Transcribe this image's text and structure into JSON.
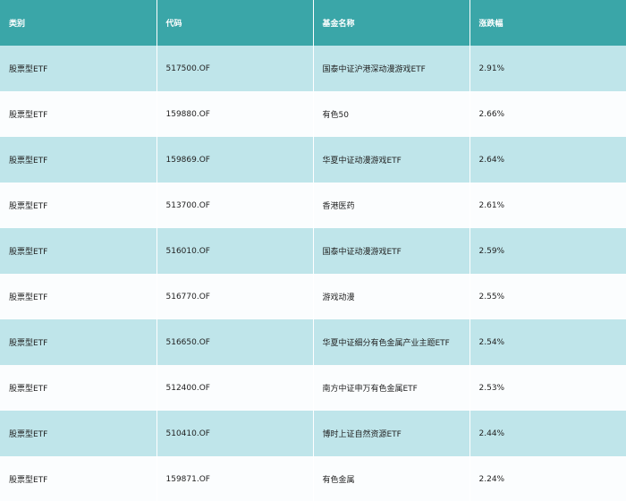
{
  "table": {
    "headers": [
      "类别",
      "代码",
      "基金名称",
      "涨跌幅"
    ],
    "rows": [
      [
        "股票型ETF",
        "517500.OF",
        "国泰中证沪港深动漫游戏ETF",
        "2.91%"
      ],
      [
        "股票型ETF",
        "159880.OF",
        "有色50",
        "2.66%"
      ],
      [
        "股票型ETF",
        "159869.OF",
        "华夏中证动漫游戏ETF",
        "2.64%"
      ],
      [
        "股票型ETF",
        "513700.OF",
        "香港医药",
        "2.61%"
      ],
      [
        "股票型ETF",
        "516010.OF",
        "国泰中证动漫游戏ETF",
        "2.59%"
      ],
      [
        "股票型ETF",
        "516770.OF",
        "游戏动漫",
        "2.55%"
      ],
      [
        "股票型ETF",
        "516650.OF",
        "华夏中证细分有色金属产业主题ETF",
        "2.54%"
      ],
      [
        "股票型ETF",
        "512400.OF",
        "南方中证申万有色金属ETF",
        "2.53%"
      ],
      [
        "股票型ETF",
        "510410.OF",
        "博时上证自然资源ETF",
        "2.44%"
      ],
      [
        "股票型ETF",
        "159871.OF",
        "有色金属",
        "2.24%"
      ]
    ]
  },
  "colors": {
    "header_bg": "#3aa6a8",
    "row_alt_bg": "#bfe5ea",
    "row_bg": "#fbfdfe"
  }
}
